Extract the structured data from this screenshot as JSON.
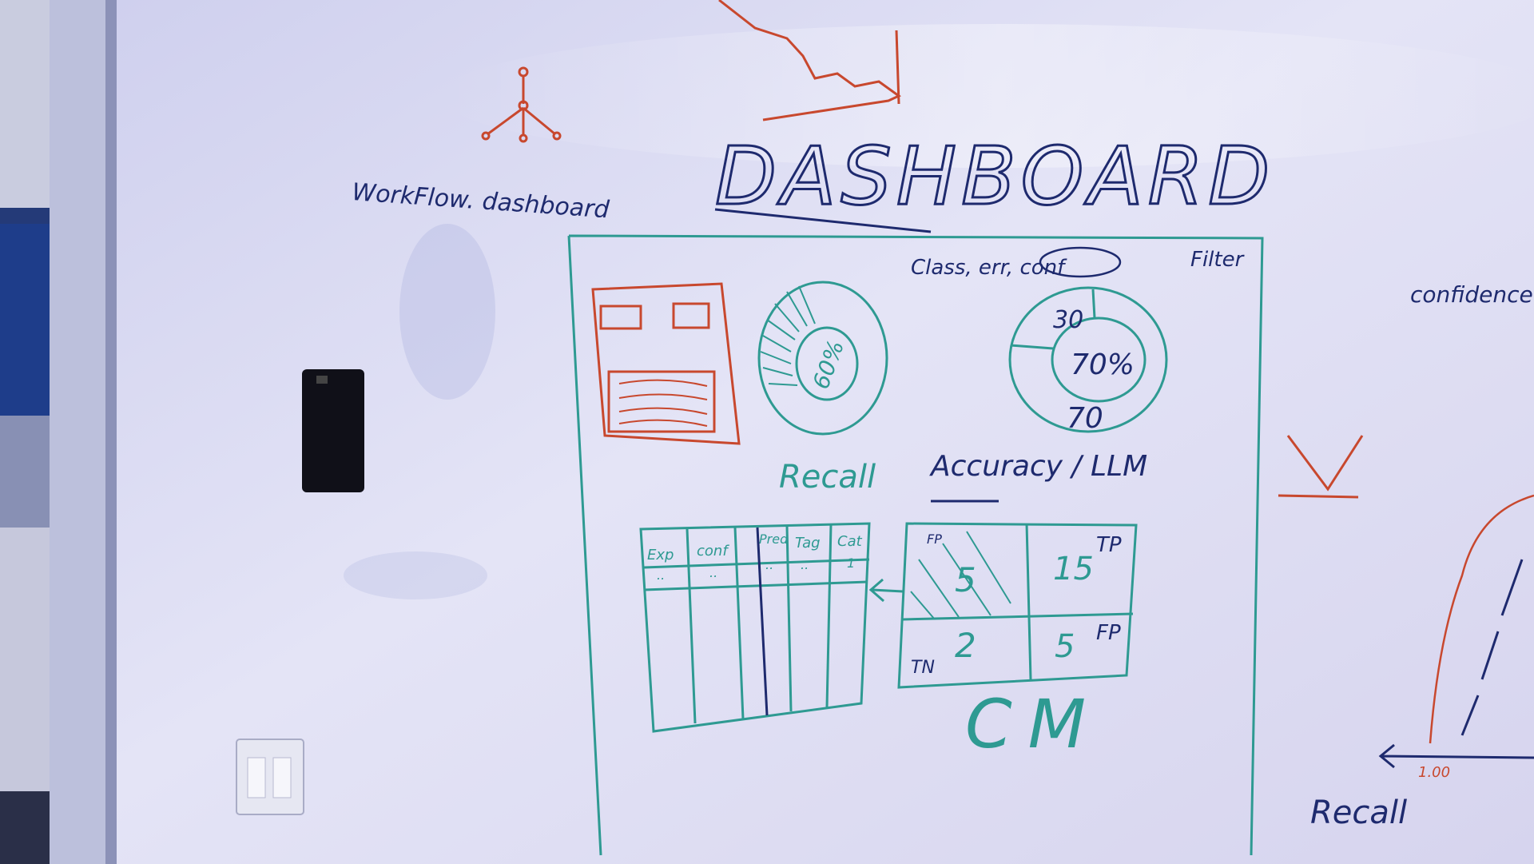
{
  "board": {
    "title": "DASHBOARD",
    "workflow_note": "WorkFlow. dashboard",
    "filter_label": "Filter",
    "filter_value": "Class, err, conf",
    "right_note": "confidence",
    "recall_bottom": "Recall",
    "axis_tick": "1.00"
  },
  "charts": {
    "pie_left_value": "60%",
    "pie_right_value": "70%",
    "pie_right_top": "30",
    "pie_right_bottom": "70",
    "recall_label": "Recall",
    "accuracy_label": "Accuracy / LLM"
  },
  "table": {
    "headers": [
      "Cat",
      "Tag",
      "Pred",
      "conf",
      "Exp"
    ],
    "first_row": [
      "1",
      "..",
      "..",
      "..",
      ".."
    ]
  },
  "confusion_matrix": {
    "tp_label": "TP",
    "tp_value": "15",
    "fp_label": "FP",
    "fp_value": "5",
    "fp_bottom_label": "FP",
    "fp_bottom_value": "5",
    "tn_label": "TN",
    "tn_value": "2",
    "caption": "CM"
  },
  "colors": {
    "board": "#dcdcf2",
    "teal_marker": "#2e9a92",
    "navy_marker": "#1e2a6e",
    "red_marker": "#c8482e"
  }
}
